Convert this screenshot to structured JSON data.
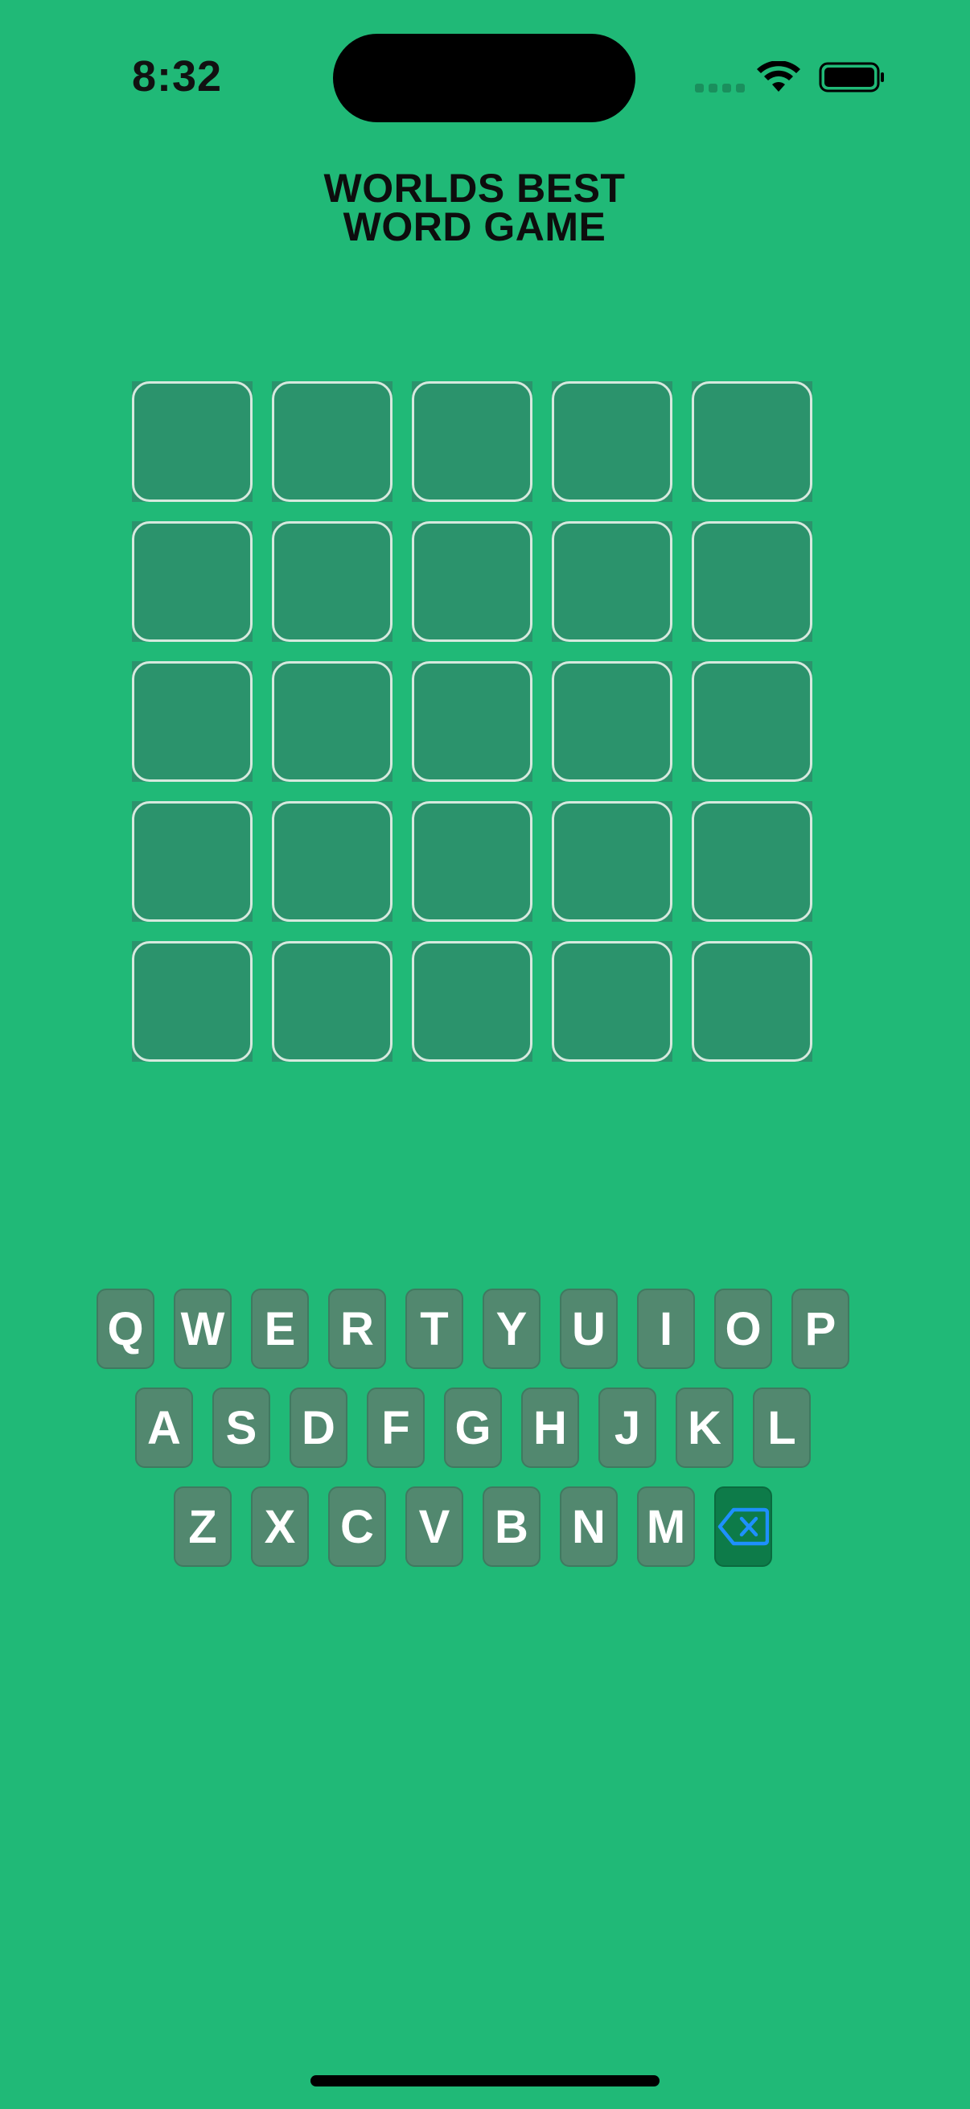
{
  "status_bar": {
    "time": "8:32"
  },
  "title": {
    "line1": "WORLDS BEST",
    "line2": "WORD GAME"
  },
  "board": {
    "rows": 5,
    "cols": 5
  },
  "keyboard": {
    "row1": [
      "Q",
      "W",
      "E",
      "R",
      "T",
      "Y",
      "U",
      "I",
      "O",
      "P"
    ],
    "row2": [
      "A",
      "S",
      "D",
      "F",
      "G",
      "H",
      "J",
      "K",
      "L"
    ],
    "row3": [
      "Z",
      "X",
      "C",
      "V",
      "B",
      "N",
      "M"
    ],
    "delete_icon": "backspace-icon"
  },
  "colors": {
    "background": "#20b977",
    "tile": "#2b936c",
    "tile_border": "#d6e9de",
    "key": "#52886f",
    "delete_key": "#0d7b49",
    "delete_icon": "#1e90ff"
  }
}
